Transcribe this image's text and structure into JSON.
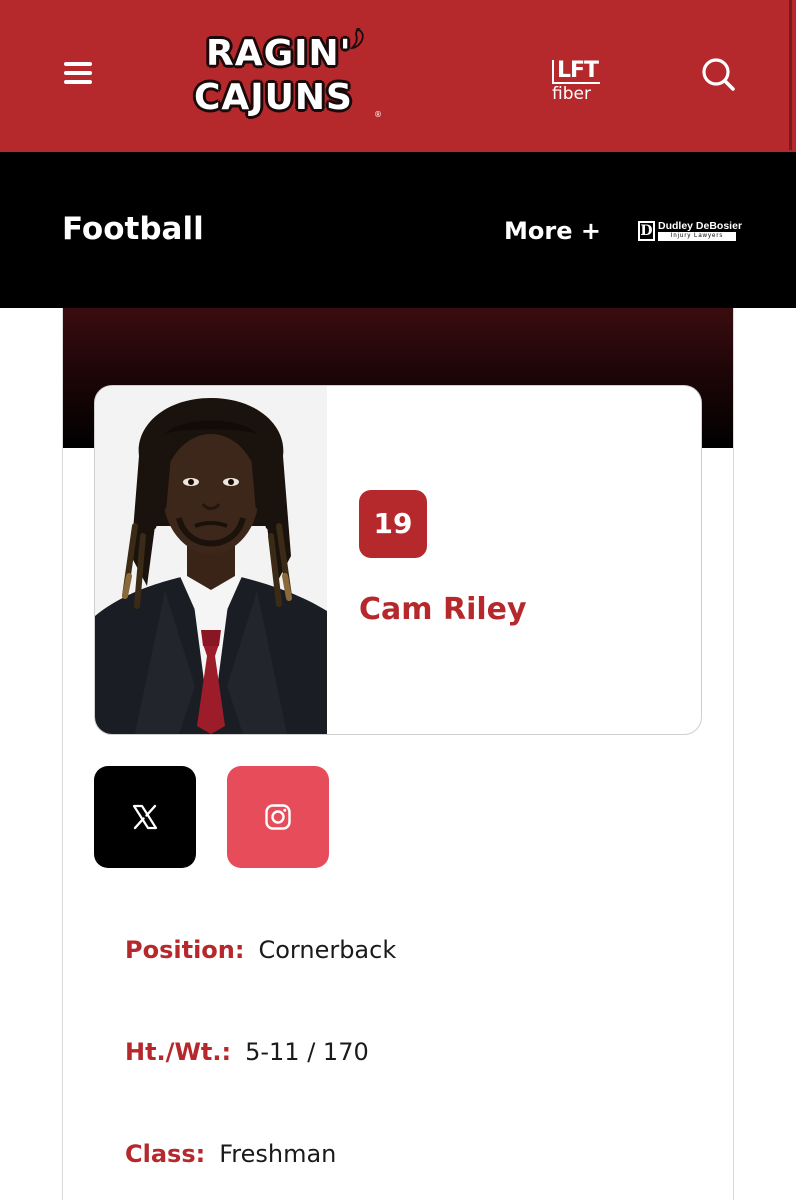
{
  "header": {
    "logo_line1": "RAGIN'",
    "logo_line2": "CAJUNS",
    "logo_registered": "®",
    "sponsor_lft_bold": "LFT",
    "sponsor_lft_light": "fiber",
    "menu_icon": "hamburger-icon",
    "search_icon": "search-icon",
    "brand_color": "#b5282c"
  },
  "sportbar": {
    "title": "Football",
    "more_label": "More +",
    "sponsor_letter": "D",
    "sponsor_name": "Dudley DeBosier",
    "sponsor_tagline": "Injury Lawyers"
  },
  "player": {
    "number": "19",
    "name": "Cam Riley",
    "photo": "player-headshot"
  },
  "social": {
    "x_icon": "x-twitter-icon",
    "instagram_icon": "instagram-icon",
    "x_color": "#000000",
    "instagram_color": "#e74c5b"
  },
  "bio": [
    {
      "label": "Position:",
      "value": "Cornerback"
    },
    {
      "label": "Ht./Wt.:",
      "value": "5-11 / 170"
    },
    {
      "label": "Class:",
      "value": "Freshman"
    }
  ]
}
